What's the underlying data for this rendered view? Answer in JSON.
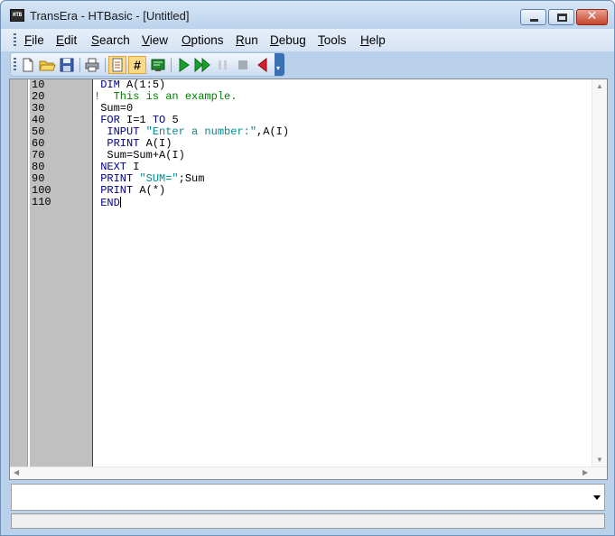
{
  "window": {
    "app_icon_text": "HTB",
    "title": "TransEra - HTBasic - [Untitled]",
    "close_glyph": "✕"
  },
  "menu": [
    {
      "label": "File",
      "mnemonic": "F",
      "rest": "ile"
    },
    {
      "label": "Edit",
      "mnemonic": "E",
      "rest": "dit"
    },
    {
      "label": "Search",
      "mnemonic": "S",
      "rest": "earch"
    },
    {
      "label": "View",
      "mnemonic": "V",
      "rest": "iew"
    },
    {
      "label": "Options",
      "mnemonic": "O",
      "rest": "ptions"
    },
    {
      "label": "Run",
      "mnemonic": "R",
      "rest": "un"
    },
    {
      "label": "Debug",
      "mnemonic": "D",
      "rest": "ebug"
    },
    {
      "label": "Tools",
      "mnemonic": "T",
      "rest": "ools"
    },
    {
      "label": "Help",
      "mnemonic": "H",
      "rest": "elp"
    }
  ],
  "toolbar": {
    "icons": [
      "new-file-icon",
      "open-folder-icon",
      "save-disk-icon",
      "print-icon",
      "program-view-icon",
      "line-numbers-icon",
      "terminal-icon",
      "run-icon",
      "continue-icon",
      "pause-icon",
      "stop-icon",
      "step-back-icon"
    ],
    "line_numbers_glyph": "#",
    "overflow_glyph": "▾",
    "accent": "#3a6fb4"
  },
  "editor": {
    "line_numbers": [
      "10",
      "20",
      "30",
      "40",
      "50",
      "60",
      "70",
      "80",
      "90",
      "100",
      "110"
    ],
    "lines": [
      {
        "indent": " ",
        "parts": [
          {
            "t": "kw",
            "v": "DIM "
          },
          {
            "t": "plain",
            "v": "A(1:5)"
          }
        ]
      },
      {
        "indent": "",
        "parts": [
          {
            "t": "comment",
            "v": "!  This is an example."
          }
        ]
      },
      {
        "indent": " ",
        "parts": [
          {
            "t": "plain",
            "v": "Sum=0"
          }
        ]
      },
      {
        "indent": " ",
        "parts": [
          {
            "t": "kw",
            "v": "FOR "
          },
          {
            "t": "plain",
            "v": "I=1 "
          },
          {
            "t": "kw",
            "v": "TO "
          },
          {
            "t": "plain",
            "v": "5"
          }
        ]
      },
      {
        "indent": "  ",
        "parts": [
          {
            "t": "kw",
            "v": "INPUT "
          },
          {
            "t": "str",
            "v": "\"Enter a number:\""
          },
          {
            "t": "plain",
            "v": ",A(I)"
          }
        ]
      },
      {
        "indent": "  ",
        "parts": [
          {
            "t": "kw",
            "v": "PRINT "
          },
          {
            "t": "plain",
            "v": "A(I)"
          }
        ]
      },
      {
        "indent": "  ",
        "parts": [
          {
            "t": "plain",
            "v": "Sum=Sum+A(I)"
          }
        ]
      },
      {
        "indent": " ",
        "parts": [
          {
            "t": "kw",
            "v": "NEXT "
          },
          {
            "t": "plain",
            "v": "I"
          }
        ]
      },
      {
        "indent": " ",
        "parts": [
          {
            "t": "kw",
            "v": "PRINT "
          },
          {
            "t": "str",
            "v": "\"SUM=\""
          },
          {
            "t": "plain",
            "v": ";Sum"
          }
        ]
      },
      {
        "indent": " ",
        "parts": [
          {
            "t": "kw",
            "v": "PRINT "
          },
          {
            "t": "plain",
            "v": "A(*)"
          }
        ]
      },
      {
        "indent": " ",
        "parts": [
          {
            "t": "kw",
            "v": "END"
          }
        ]
      }
    ],
    "colors": {
      "keyword": "#00008b",
      "string": "#008b8b",
      "comment": "#008000",
      "gutter": "#c0c0c0"
    }
  },
  "scroll": {
    "up": "▲",
    "down": "▼",
    "left": "◀",
    "right": "▶"
  },
  "command_line": {
    "value": ""
  },
  "status": {
    "text": ""
  }
}
